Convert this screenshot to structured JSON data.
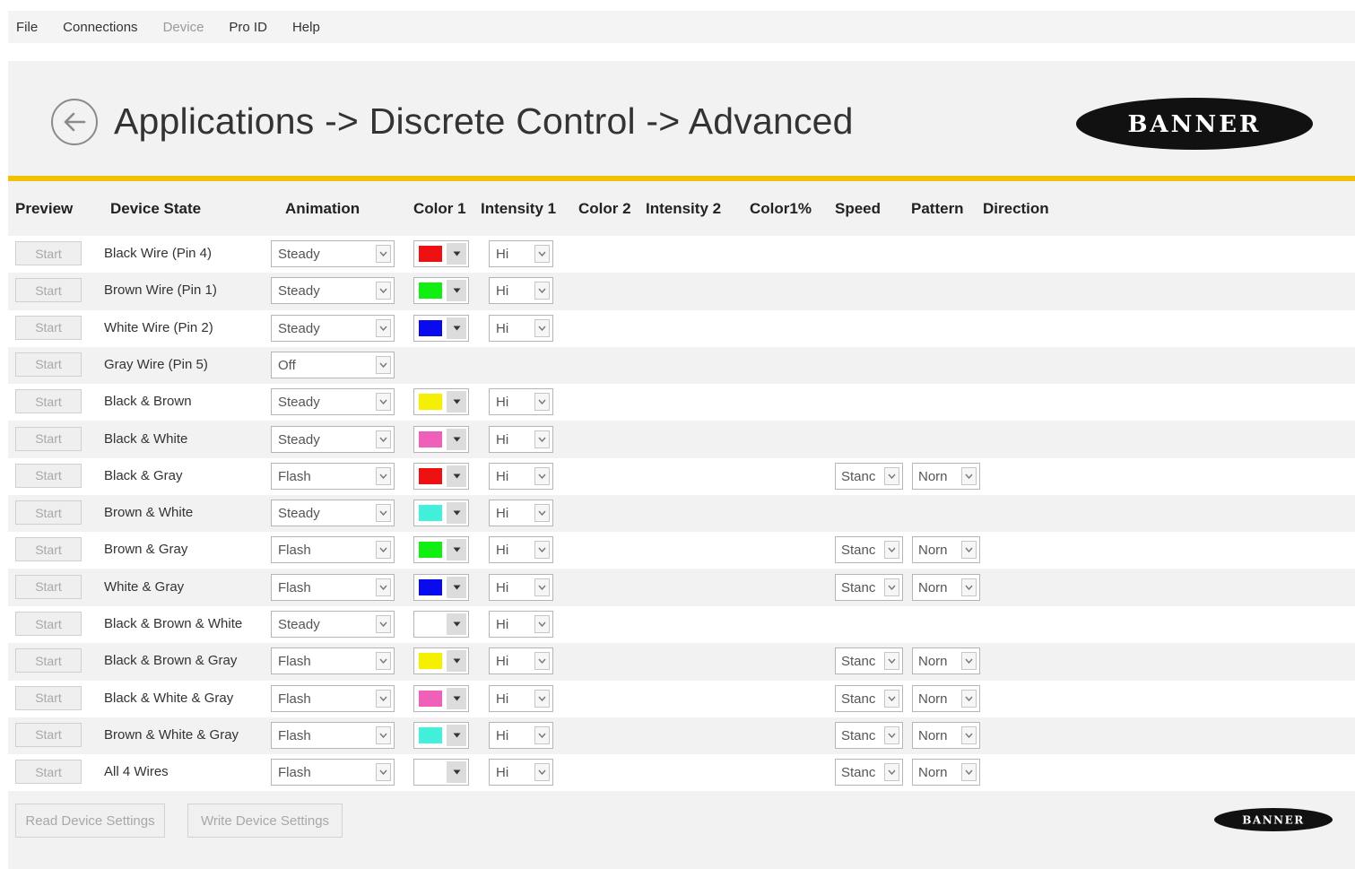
{
  "menu": [
    "File",
    "Connections",
    "Device",
    "Pro ID",
    "Help"
  ],
  "menu_disabled": [
    "Device"
  ],
  "header": {
    "title": "Applications -> Discrete Control -> Advanced",
    "logo_text": "BANNER"
  },
  "columns": {
    "preview": "Preview",
    "device_state": "Device State",
    "animation": "Animation",
    "color1": "Color 1",
    "intensity1": "Intensity 1",
    "color2": "Color 2",
    "intensity2": "Intensity 2",
    "color1pct": "Color1%",
    "speed": "Speed",
    "pattern": "Pattern",
    "direction": "Direction"
  },
  "colors": {
    "red": "#ee1111",
    "green": "#11ee11",
    "blue": "#0a0aee",
    "yellow": "#f5f000",
    "pink": "#f060b8",
    "cyan": "#40f0d8",
    "white": "#ffffff",
    "accent_bar": "#f2c200"
  },
  "rows": [
    {
      "start": "Start",
      "state": "Black Wire (Pin 4)",
      "animation": "Steady",
      "color1": "red",
      "intensity1": "Hi"
    },
    {
      "start": "Start",
      "state": "Brown Wire (Pin 1)",
      "animation": "Steady",
      "color1": "green",
      "intensity1": "Hi"
    },
    {
      "start": "Start",
      "state": "White Wire (Pin 2)",
      "animation": "Steady",
      "color1": "blue",
      "intensity1": "Hi"
    },
    {
      "start": "Start",
      "state": "Gray Wire (Pin 5)",
      "animation": "Off"
    },
    {
      "start": "Start",
      "state": "Black & Brown",
      "animation": "Steady",
      "color1": "yellow",
      "intensity1": "Hi"
    },
    {
      "start": "Start",
      "state": "Black & White",
      "animation": "Steady",
      "color1": "pink",
      "intensity1": "Hi"
    },
    {
      "start": "Start",
      "state": "Black & Gray",
      "animation": "Flash",
      "color1": "red",
      "intensity1": "Hi",
      "speed": "Stanc",
      "pattern": "Norn"
    },
    {
      "start": "Start",
      "state": "Brown & White",
      "animation": "Steady",
      "color1": "cyan",
      "intensity1": "Hi"
    },
    {
      "start": "Start",
      "state": "Brown & Gray",
      "animation": "Flash",
      "color1": "green",
      "intensity1": "Hi",
      "speed": "Stanc",
      "pattern": "Norn"
    },
    {
      "start": "Start",
      "state": "White & Gray",
      "animation": "Flash",
      "color1": "blue",
      "intensity1": "Hi",
      "speed": "Stanc",
      "pattern": "Norn"
    },
    {
      "start": "Start",
      "state": "Black & Brown & White",
      "animation": "Steady",
      "color1": "white",
      "intensity1": "Hi"
    },
    {
      "start": "Start",
      "state": "Black & Brown & Gray",
      "animation": "Flash",
      "color1": "yellow",
      "intensity1": "Hi",
      "speed": "Stanc",
      "pattern": "Norn"
    },
    {
      "start": "Start",
      "state": "Black & White & Gray",
      "animation": "Flash",
      "color1": "pink",
      "intensity1": "Hi",
      "speed": "Stanc",
      "pattern": "Norn"
    },
    {
      "start": "Start",
      "state": "Brown & White & Gray",
      "animation": "Flash",
      "color1": "cyan",
      "intensity1": "Hi",
      "speed": "Stanc",
      "pattern": "Norn"
    },
    {
      "start": "Start",
      "state": "All 4 Wires",
      "animation": "Flash",
      "color1": "white",
      "intensity1": "Hi",
      "speed": "Stanc",
      "pattern": "Norn"
    }
  ],
  "buttons": {
    "read": "Read Device Settings",
    "write": "Write Device Settings"
  }
}
